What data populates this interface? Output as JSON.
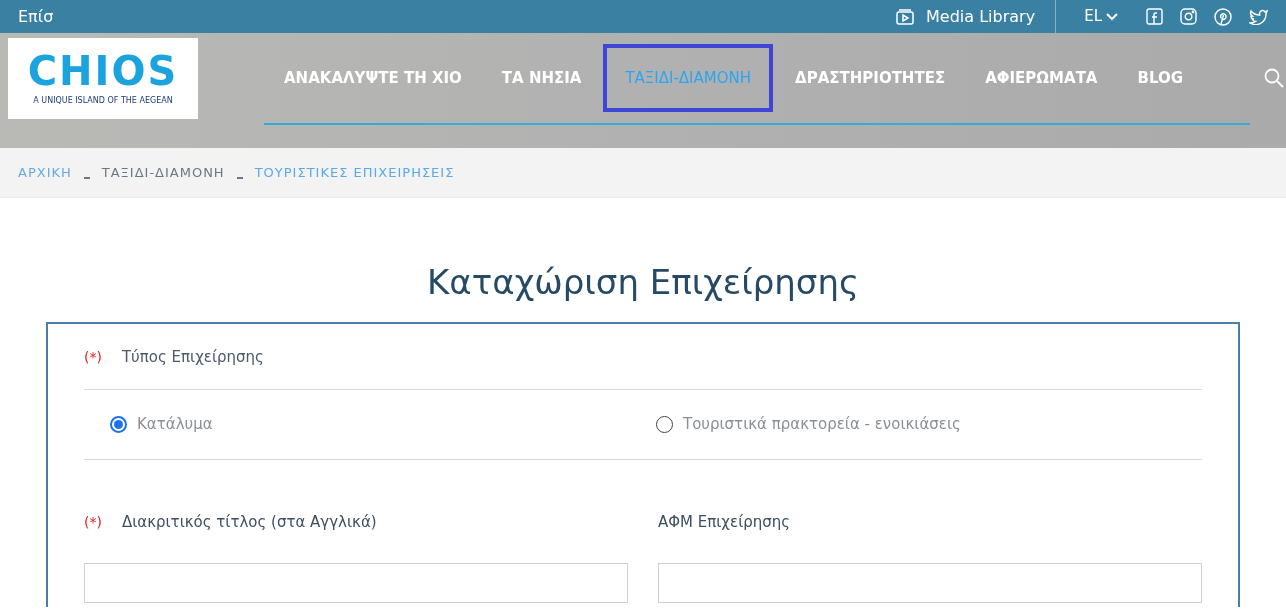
{
  "top_bar": {
    "left_text": "Επίσ",
    "media_library": "Media Library",
    "language": "EL"
  },
  "logo": {
    "title": "CHIOS",
    "tagline": "A UNIQUE ISLAND OF THE AEGEAN"
  },
  "nav": [
    {
      "label": "ΑΝΑΚΑΛΥΨΤΕ ΤΗ ΧΙΟ",
      "selected": false
    },
    {
      "label": "ΤΑ ΝΗΣΙΑ",
      "selected": false
    },
    {
      "label": "ΤΑΞΙΔΙ-ΔΙΑΜΟΝΗ",
      "selected": true
    },
    {
      "label": "ΔΡΑΣΤΗΡΙΟΤΗΤΕΣ",
      "selected": false
    },
    {
      "label": "ΑΦΙΕΡΩΜΑΤΑ",
      "selected": false
    },
    {
      "label": "BLOG",
      "selected": false
    }
  ],
  "breadcrumbs": [
    {
      "label": "ΑΡΧΙΚΗ",
      "kind": "link"
    },
    {
      "label": "ΤΑΞΙΔΙ-ΔΙΑΜΟΝΗ",
      "kind": "plain"
    },
    {
      "label": "ΤΟΥΡΙΣΤΙΚΕΣ ΕΠΙΧΕΙΡΗΣΕΙΣ",
      "kind": "current"
    }
  ],
  "heading": "Καταχώριση Επιχείρησης",
  "form": {
    "business_type": {
      "required_mark": "(*)",
      "label": "Τύπος Επιχείρησης",
      "options": [
        {
          "label": "Κατάλυμα",
          "selected": true
        },
        {
          "label": "Τουριστικά πρακτορεία - ενοικιάσεις",
          "selected": false
        }
      ]
    },
    "fields": [
      {
        "required_mark": "(*)",
        "label": "Διακριτικός τίτλος (στα Αγγλικά)"
      },
      {
        "label": "ΑΦΜ Επιχείρησης"
      }
    ]
  }
}
